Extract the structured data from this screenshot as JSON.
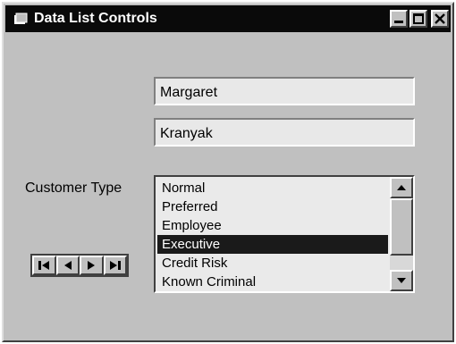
{
  "window": {
    "title": "Data List Controls"
  },
  "icons": {
    "app": "app-icon",
    "minimize": "minimize-icon",
    "maximize": "maximize-icon",
    "close": "close-icon"
  },
  "fields": {
    "first_name": "Margaret",
    "last_name": "Kranyak"
  },
  "customer_type": {
    "label": "Customer Type",
    "options": [
      "Normal",
      "Preferred",
      "Employee",
      "Executive",
      "Credit Risk",
      "Known Criminal"
    ],
    "selected": "Executive"
  },
  "navigator": {
    "buttons": [
      "first-record",
      "previous-record",
      "next-record",
      "last-record"
    ]
  }
}
